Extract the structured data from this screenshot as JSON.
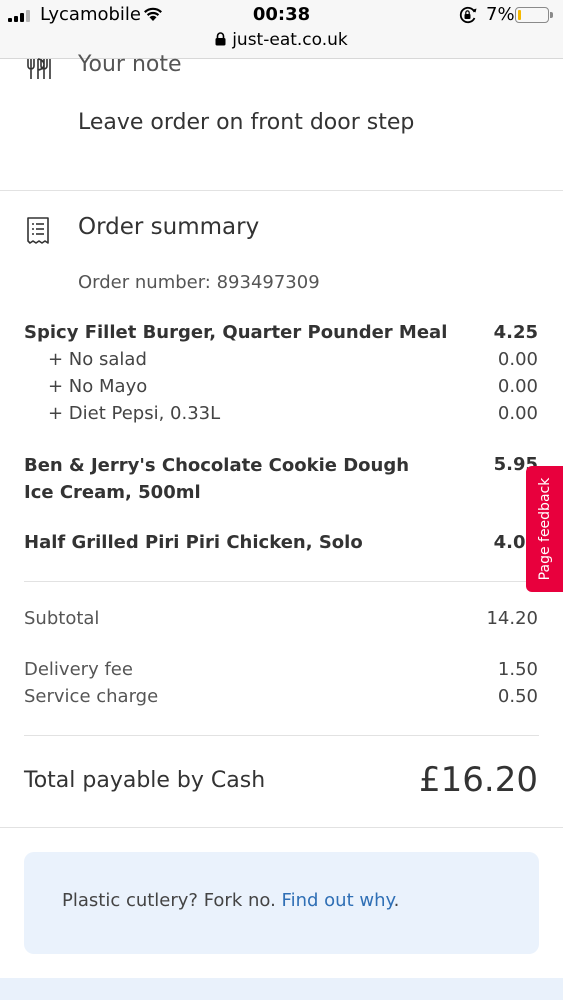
{
  "status_bar": {
    "carrier": "Lycamobile",
    "time": "00:38",
    "url": "just-eat.co.uk",
    "battery": "7%"
  },
  "note": {
    "title": "Your note",
    "text": "Leave order on front door step"
  },
  "order_summary": {
    "title": "Order summary",
    "order_number": "Order number: 893497309",
    "items": [
      {
        "name": "Spicy Fillet Burger, Quarter Pounder Meal",
        "price": "4.25",
        "modifiers": [
          {
            "label": "+ No salad",
            "price": "0.00"
          },
          {
            "label": "+ No Mayo",
            "price": "0.00"
          },
          {
            "label": "+ Diet Pepsi, 0.33L",
            "price": "0.00"
          }
        ]
      },
      {
        "name": "Ben & Jerry's Chocolate Cookie Dough Ice Cream, 500ml",
        "price": "5.95"
      },
      {
        "name": "Half Grilled Piri Piri Chicken, Solo",
        "price": "4.00"
      }
    ],
    "subtotal_label": "Subtotal",
    "subtotal": "14.20",
    "delivery_label": "Delivery fee",
    "delivery": "1.50",
    "service_label": "Service charge",
    "service": "0.50",
    "total_label": "Total payable by Cash",
    "total": "£16.20"
  },
  "feedback_tab": "Page feedback",
  "cutlery": {
    "text": "Plastic cutlery? Fork no.",
    "link": "Find out why",
    "suffix": "."
  },
  "colors": {
    "feedback": "#e8003d",
    "link": "#2f6fb5",
    "info_box": "#eaf2fc"
  }
}
